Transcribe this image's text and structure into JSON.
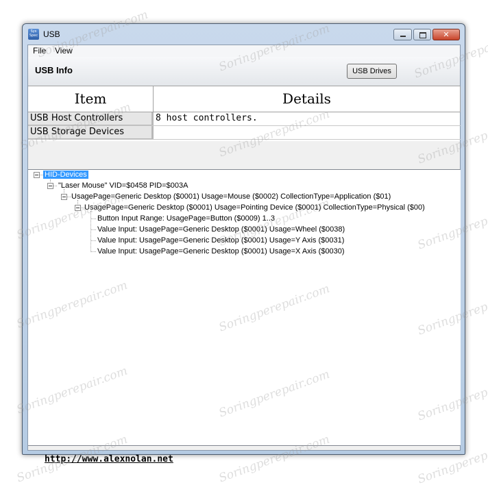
{
  "window": {
    "title": "USB",
    "icon_text": "Sys Spec",
    "close_glyph": "✕"
  },
  "menu": {
    "file": "File",
    "view": "View"
  },
  "header": {
    "title": "USB Info",
    "usb_drives_button": "USB Drives"
  },
  "grid": {
    "col_item": "Item",
    "col_details": "Details",
    "rows": [
      {
        "item": "USB Host Controllers",
        "details": "8 host controllers."
      },
      {
        "item": "USB Storage Devices",
        "details": ""
      }
    ]
  },
  "tree": {
    "root": "HID-Devices",
    "device": "\"Laser Mouse\"  VID=$0458 PID=$003A",
    "collection1": "UsagePage=Generic Desktop ($0001)  Usage=Mouse ($0002)  CollectionType=Application ($01)",
    "collection2": "UsagePage=Generic Desktop ($0001)  Usage=Pointing Device ($0001)  CollectionType=Physical ($00)",
    "leaves": [
      "Button Input Range: UsagePage=Button ($0009)  1..3",
      "Value Input: UsagePage=Generic Desktop ($0001) Usage=Wheel ($0038)",
      "Value Input: UsagePage=Generic Desktop ($0001) Usage=Y Axis ($0031)",
      "Value Input: UsagePage=Generic Desktop ($0001) Usage=X Axis ($0030)"
    ]
  },
  "footer": {
    "link": "http://www.alexnolan.net"
  },
  "watermark": "Soringperepair.com"
}
